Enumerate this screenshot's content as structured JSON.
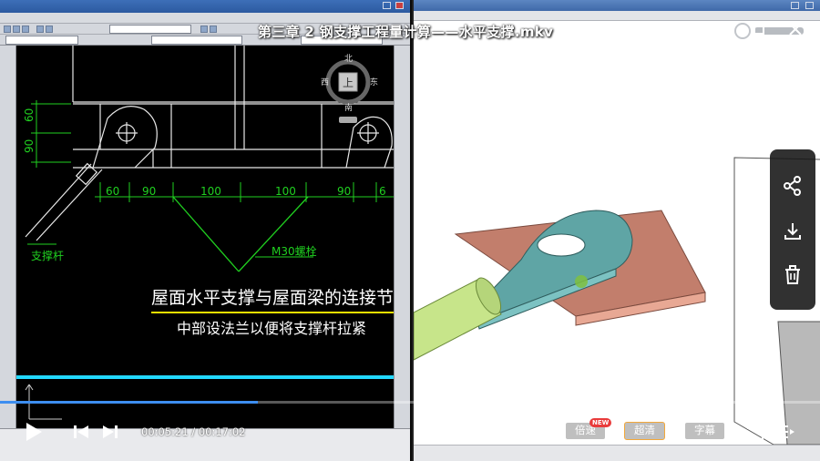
{
  "player": {
    "title": "第三章 2 钢支撑工程量计算——水平支撑.mkv",
    "time_current": "00:05:21",
    "time_total": "00:17:02",
    "time_separator": " / ",
    "progress": 0.314,
    "volume": 0.6,
    "speed_label": "倍速",
    "speed_badge": "NEW",
    "quality_label": "超清",
    "subtitle_label": "字幕",
    "accent_color": "#3d8ef0",
    "quality_border_color": "#f2a83a"
  },
  "cad": {
    "compass": {
      "north": "北",
      "south": "南",
      "east": "东",
      "west": "西",
      "top": "上"
    },
    "dimensions": [
      "60",
      "90",
      "100",
      "100",
      "90",
      "6"
    ],
    "vertical_dims": [
      "60",
      "90"
    ],
    "label_brace": "支撑杆",
    "label_bolt": "M30螺栓",
    "note_line1": "屋面水平支撑与屋面梁的连接节",
    "note_line2": "中部设法兰以便将支撑杆拉紧"
  }
}
